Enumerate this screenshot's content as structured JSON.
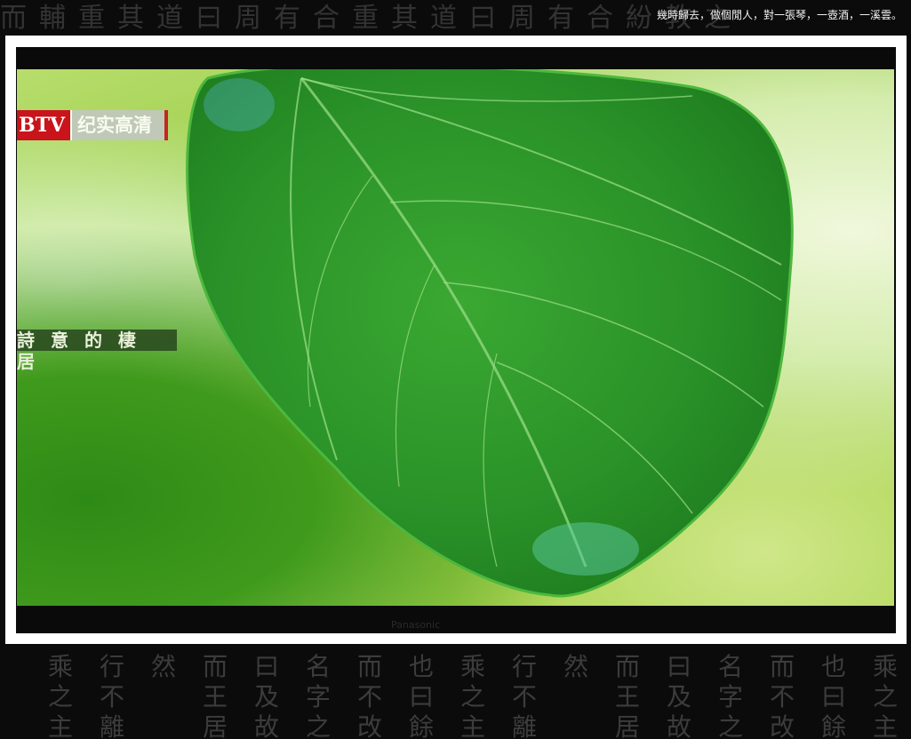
{
  "caption": "幾時歸去，做個閒人，對一張琴，一壺酒，一溪雲。",
  "screen": {
    "channel_logo": "BTV",
    "channel_name": "纪实高清",
    "program_title": "詩意的棲居"
  },
  "tv_brand": "Panasonic",
  "colors": {
    "leaf": "#2f9a2a",
    "logo_red": "#c8141a",
    "frame": "#ffffff"
  },
  "background": {
    "top_calligraphy": "而輔重其道曰周有合重其道曰周有合紛教之",
    "bottom_columns": [
      "乘之主",
      "行不離",
      "然",
      "而王居",
      "曰及故",
      "名字之",
      "而不改",
      "也曰餘",
      "乘之主",
      "行不離",
      "然",
      "而王居",
      "曰及故",
      "名字之",
      "而不改",
      "也曰餘",
      "乘之主"
    ]
  }
}
